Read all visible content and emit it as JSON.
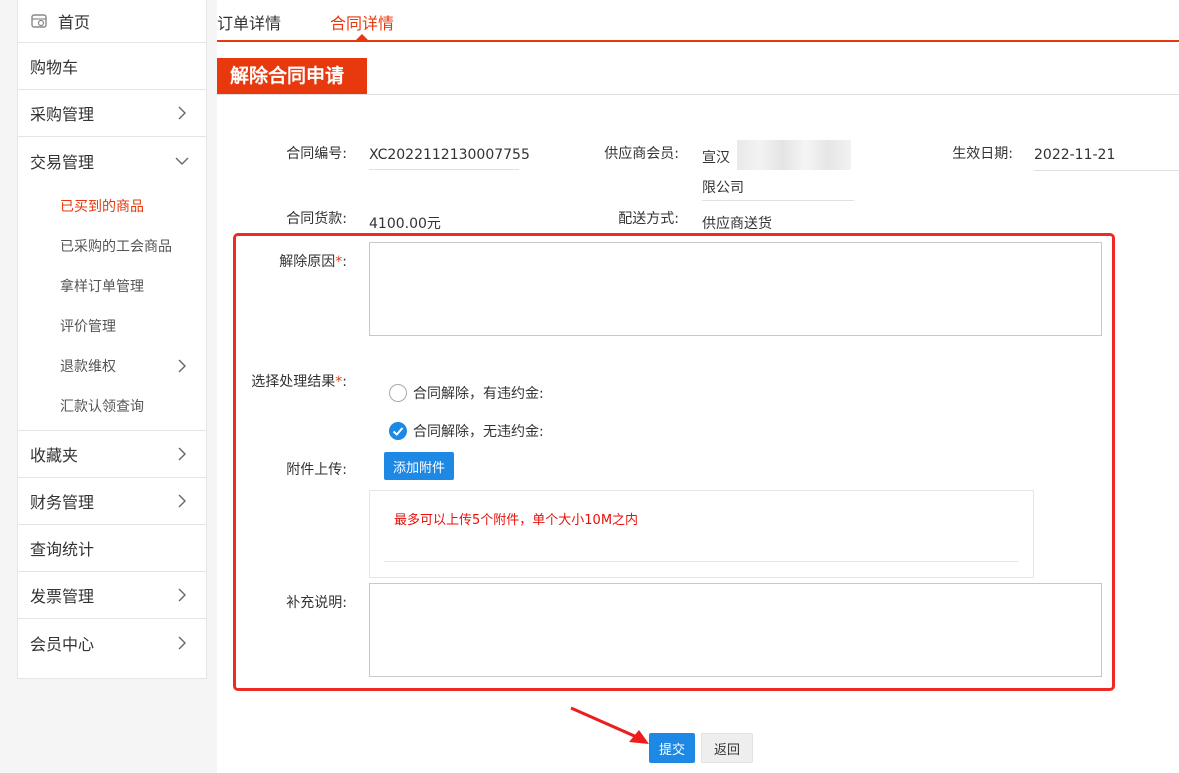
{
  "sidebar": {
    "home": "首页",
    "cart": "购物车",
    "purchase": "采购管理",
    "trade": "交易管理",
    "trade_sub": [
      "已买到的商品",
      "已采购的工会商品",
      "拿样订单管理",
      "评价管理",
      "退款维权",
      "汇款认领查询"
    ],
    "favorites": "收藏夹",
    "finance": "财务管理",
    "query": "查询统计",
    "invoice": "发票管理",
    "member": "会员中心"
  },
  "tabs": [
    "订单详情",
    "合同详情"
  ],
  "section_title": "解除合同申请",
  "info": {
    "contract_no_label": "合同编号:",
    "contract_no": "XC2022112130007755",
    "supplier_label": "供应商会员:",
    "supplier_line1": "宣汉",
    "supplier_line2": "限公司",
    "effective_label": "生效日期:",
    "effective": "2022-11-21",
    "amount_label": "合同货款:",
    "amount": "4100.00元",
    "delivery_label": "配送方式:",
    "delivery": "供应商送货"
  },
  "form": {
    "reason_label": "解除原因",
    "reason_suffix": ":",
    "result_label": "选择处理结果",
    "result_suffix": ":",
    "option1": "合同解除，有违约金:",
    "option2": "合同解除，无违约金:",
    "selected_option": 2,
    "attach_label": "附件上传:",
    "attach_button": "添加附件",
    "attach_note": "最多可以上传5个附件，单个大小10M之内",
    "supplement_label": "补充说明:",
    "required_mark": "*"
  },
  "actions": {
    "submit": "提交",
    "back": "返回"
  },
  "colors": {
    "accent": "#e8380d",
    "primary_button": "#1e88e5",
    "highlight_box": "#ee2a24"
  }
}
